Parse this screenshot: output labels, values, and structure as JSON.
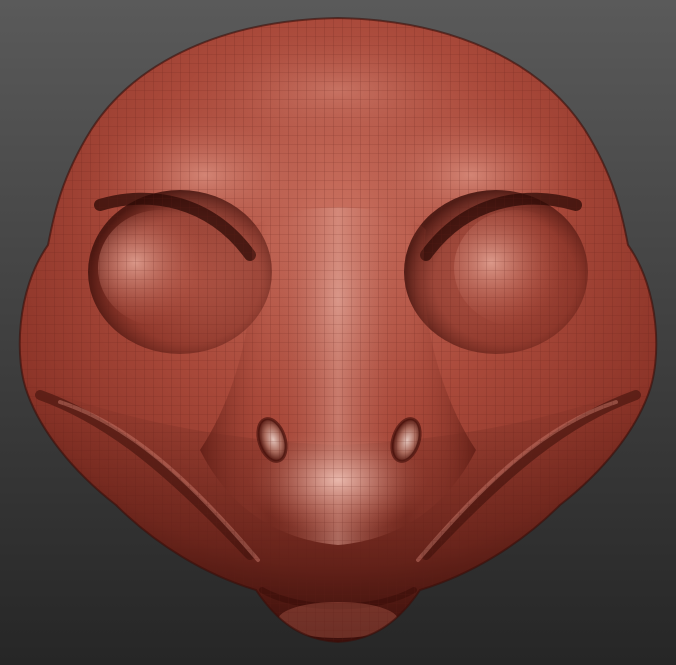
{
  "viewport": {
    "kind": "3d-sculpt-render",
    "subject": "creature-head-base-mesh",
    "background_top": "#5a5a5a",
    "background_bottom": "#262626",
    "clay_highlight": "#d98d7d",
    "clay_base": "#a9493a",
    "clay_mid": "#8c3428",
    "clay_shadow": "#4e1711",
    "wireframe_color": "#5c1d15"
  }
}
